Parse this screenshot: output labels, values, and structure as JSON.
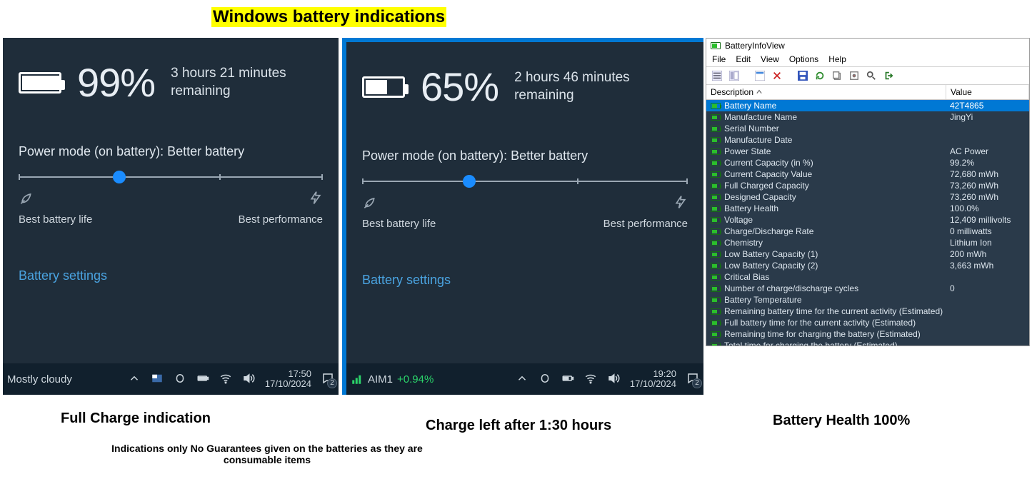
{
  "title": "Windows battery indications",
  "flyouts": {
    "left": {
      "percent": "99%",
      "battery_fill_pct": 98,
      "remaining_l1": "3 hours 21 minutes",
      "remaining_l2": "remaining",
      "power_mode_label": "Power mode (on battery): Better battery",
      "slider_pos_pct": 33,
      "best_battery_label": "Best battery life",
      "best_perf_label": "Best performance",
      "battery_settings_link": "Battery settings",
      "taskbar": {
        "weather_text": "Mostly cloudy",
        "time": "17:50",
        "date": "17/10/2024",
        "notif_count": "2"
      }
    },
    "right": {
      "percent": "65%",
      "battery_fill_pct": 55,
      "remaining_l1": "2 hours 46 minutes",
      "remaining_l2": "remaining",
      "power_mode_label": "Power mode (on battery): Better battery",
      "slider_pos_pct": 33,
      "best_battery_label": "Best battery life",
      "best_perf_label": "Best performance",
      "battery_settings_link": "Battery settings",
      "taskbar": {
        "stock_name": "AIM1",
        "stock_change": "+0.94%",
        "time": "19:20",
        "date": "17/10/2024",
        "notif_count": "2"
      }
    }
  },
  "infoview": {
    "window_title": "BatteryInfoView",
    "menu": [
      "File",
      "Edit",
      "View",
      "Options",
      "Help"
    ],
    "columns": {
      "desc": "Description",
      "value": "Value"
    },
    "rows": [
      {
        "desc": "Battery Name",
        "value": "42T4865",
        "selected": true
      },
      {
        "desc": "Manufacture Name",
        "value": "JingYi"
      },
      {
        "desc": "Serial Number",
        "value": ""
      },
      {
        "desc": "Manufacture Date",
        "value": ""
      },
      {
        "desc": "Power State",
        "value": "AC Power"
      },
      {
        "desc": "Current Capacity (in %)",
        "value": "99.2%"
      },
      {
        "desc": "Current Capacity Value",
        "value": "72,680 mWh"
      },
      {
        "desc": "Full Charged Capacity",
        "value": "73,260 mWh"
      },
      {
        "desc": "Designed Capacity",
        "value": "73,260 mWh"
      },
      {
        "desc": "Battery Health",
        "value": "100.0%"
      },
      {
        "desc": "Voltage",
        "value": "12,409 millivolts"
      },
      {
        "desc": "Charge/Discharge Rate",
        "value": "0 milliwatts"
      },
      {
        "desc": "Chemistry",
        "value": "Lithium Ion"
      },
      {
        "desc": "Low Battery Capacity (1)",
        "value": "200 mWh"
      },
      {
        "desc": "Low Battery Capacity (2)",
        "value": "3,663 mWh"
      },
      {
        "desc": "Critical Bias",
        "value": ""
      },
      {
        "desc": "Number of charge/discharge cycles",
        "value": "0"
      },
      {
        "desc": "Battery Temperature",
        "value": ""
      },
      {
        "desc": "Remaining battery time for the current activity (Estimated)",
        "value": ""
      },
      {
        "desc": "Full battery time for the current activity (Estimated)",
        "value": ""
      },
      {
        "desc": "Remaining time for charging the battery (Estimated)",
        "value": ""
      },
      {
        "desc": "Total  time for charging the battery (Estimated)",
        "value": ""
      }
    ]
  },
  "captions": {
    "cap1": "Full Charge indication",
    "cap2": "Charge left after 1:30 hours",
    "cap3": "Battery Health 100%",
    "disclaimer": "Indications only No Guarantees given on the batteries as they are consumable items"
  }
}
